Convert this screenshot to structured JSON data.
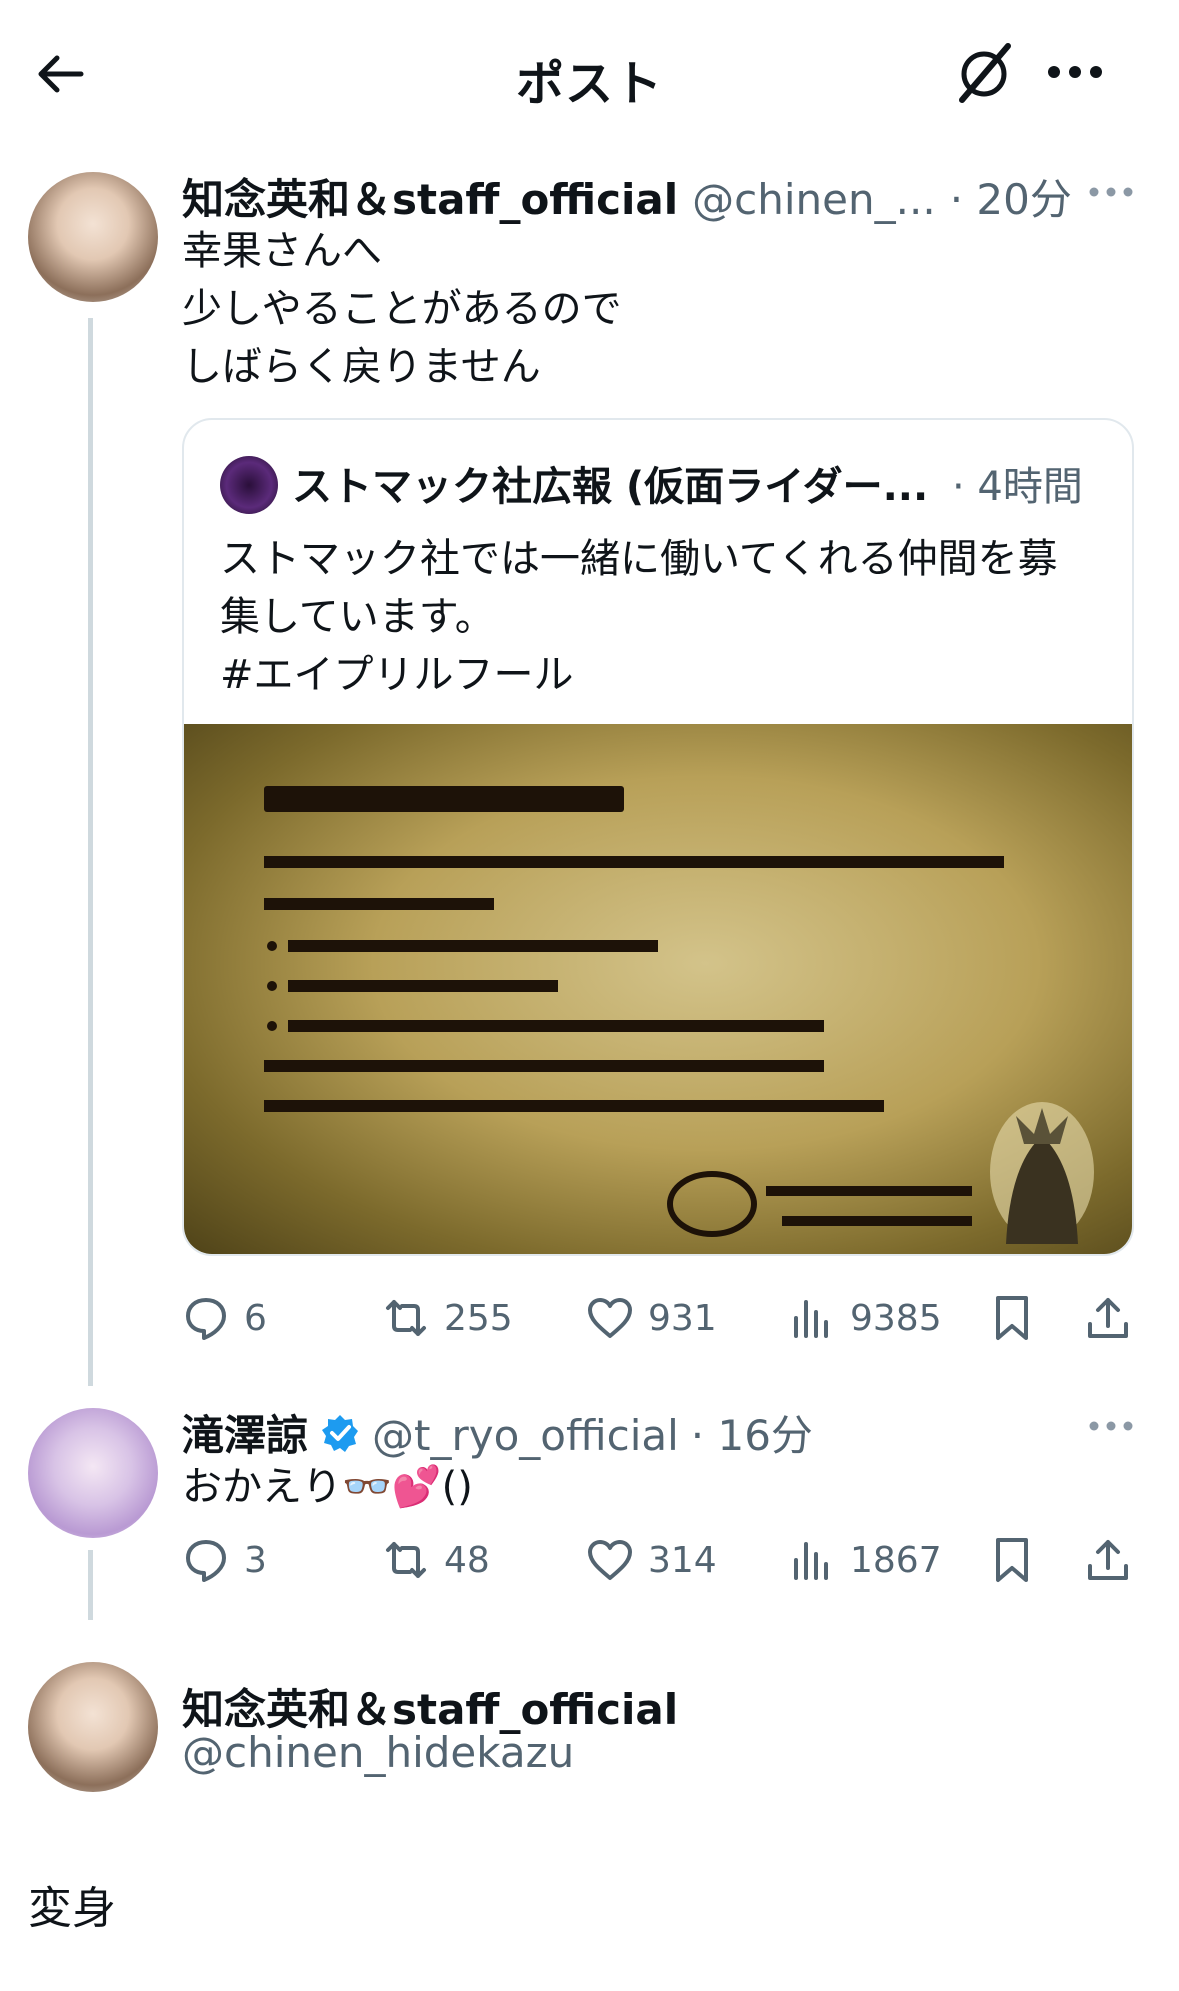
{
  "header": {
    "title": "ポスト",
    "back_icon": "arrow-left-icon",
    "grok_icon": "grok-icon",
    "more_icon": "more-icon"
  },
  "tweet1": {
    "name": "知念英和＆staff_official",
    "handle": "@chinen_...",
    "time": "· 20分",
    "lines": [
      "幸果さんへ",
      "少しやることがあるので",
      "しばらく戻りません"
    ],
    "quote": {
      "name": "ストマック社広報 (仮面ライダー...",
      "time": "· 4時間",
      "lines": [
        "ストマック社では一緒に働いてくれる仲間を募",
        "集しています。",
        "#エイプリルフール"
      ]
    },
    "actions": {
      "replies": "6",
      "retweets": "255",
      "likes": "931",
      "views": "9385"
    }
  },
  "tweet2": {
    "name": "滝澤諒",
    "handle": "@t_ryo_official",
    "time": "· 16分",
    "text": "おかえり👓💕()",
    "actions": {
      "replies": "3",
      "retweets": "48",
      "likes": "314",
      "views": "1867"
    }
  },
  "tweet3": {
    "name": "知念英和＆staff_official",
    "handle": "@chinen_hidekazu",
    "text": "変身"
  },
  "colors": {
    "text": "#0f1419",
    "muted": "#536471",
    "verified": "#1d9bf0",
    "line": "#cfd9de"
  }
}
